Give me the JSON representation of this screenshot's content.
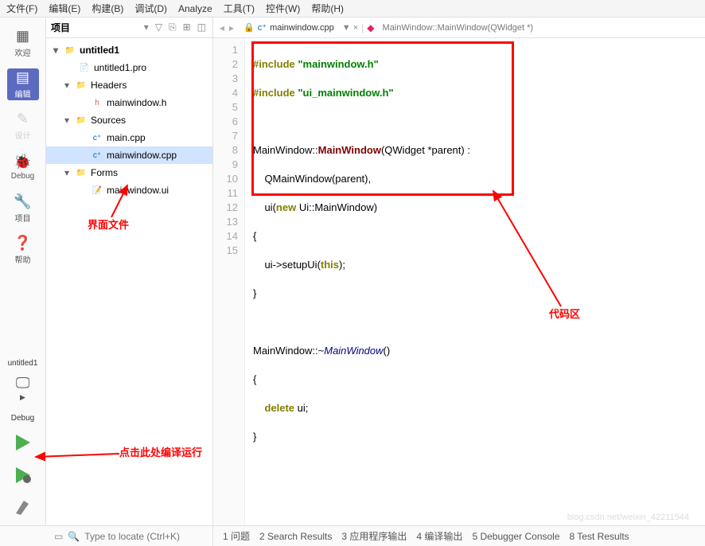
{
  "menu": [
    "文件(F)",
    "编辑(E)",
    "构建(B)",
    "调试(D)",
    "Analyze",
    "工具(T)",
    "控件(W)",
    "帮助(H)"
  ],
  "rail": {
    "welcome": "欢迎",
    "edit": "编辑",
    "design": "设计",
    "debug": "Debug",
    "project": "项目",
    "help": "帮助",
    "target": "untitled1",
    "config": "Debug"
  },
  "panel": {
    "title": "项目"
  },
  "tree": {
    "root": "untitled1",
    "pro": "untitled1.pro",
    "headers": "Headers",
    "mainh": "mainwindow.h",
    "sources": "Sources",
    "maincpp": "main.cpp",
    "mwcpp": "mainwindow.cpp",
    "forms": "Forms",
    "mwui": "mainwindow.ui"
  },
  "editor": {
    "tab": "mainwindow.cpp",
    "breadcrumb": "MainWindow::MainWindow(QWidget *)",
    "arrow": "▼ ×"
  },
  "code": {
    "l1a": "#include",
    "l1b": "\"mainwindow.h\"",
    "l2a": "#include",
    "l2b": "\"ui_mainwindow.h\"",
    "l4a": "MainWindow::",
    "l4b": "MainWindow",
    "l4c": "(QWidget *parent) :",
    "l5": "    QMainWindow(parent),",
    "l6a": "    ui(",
    "l6b": "new",
    "l6c": " Ui::MainWindow)",
    "l7": "{",
    "l8a": "    ui->setupUi(",
    "l8b": "this",
    "l8c": ");",
    "l9": "}",
    "l11a": "MainWindow::~",
    "l11b": "MainWindow",
    "l11c": "()",
    "l12": "{",
    "l13a": "    ",
    "l13b": "delete",
    "l13c": " ui;",
    "l14": "}"
  },
  "lines": [
    "1",
    "2",
    "3",
    "4",
    "5",
    "6",
    "7",
    "8",
    "9",
    "10",
    "11",
    "12",
    "13",
    "14",
    "15"
  ],
  "annot": {
    "ui_file": "界面文件",
    "code_area": "代码区",
    "run_hint": "点击此处编译运行"
  },
  "status": {
    "search": "Type to locate (Ctrl+K)",
    "tabs": [
      "1 问题",
      "2 Search Results",
      "3 应用程序输出",
      "4 编译输出",
      "5 Debugger Console",
      "8 Test Results"
    ]
  },
  "watermark": "blog.csdn.net/weixin_42211544"
}
